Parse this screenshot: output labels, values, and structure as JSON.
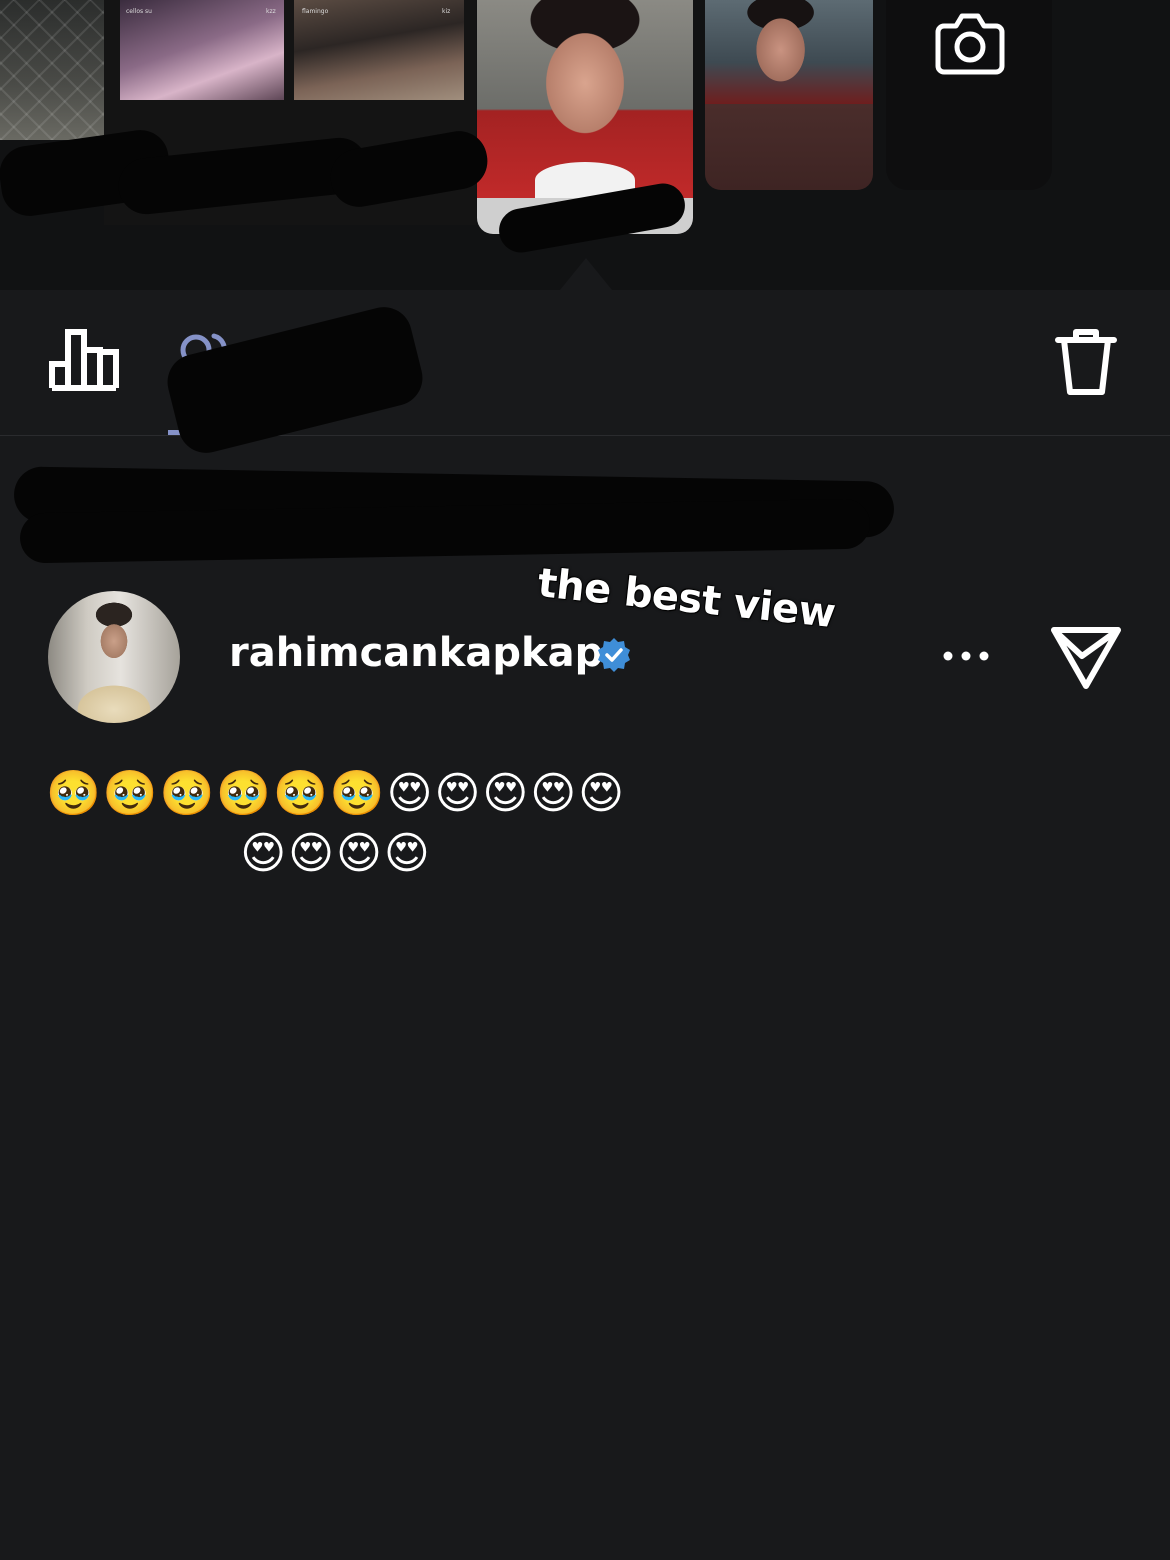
{
  "story_tray": {
    "items": [
      {
        "kind": "story",
        "thumbnail": "fence-photo"
      },
      {
        "kind": "story",
        "thumbnail": "collage-photo",
        "tags": [
          "cellos su",
          "kzz",
          "flamingo",
          "kiz"
        ]
      },
      {
        "kind": "story",
        "thumbnail": "portrait-photo",
        "selected": true
      },
      {
        "kind": "story",
        "thumbnail": "portrait-photo-2"
      },
      {
        "kind": "camera",
        "icon": "camera-icon"
      }
    ]
  },
  "actions": {
    "insights_icon": "bar-chart-icon",
    "viewers_icon": "people-icon",
    "delete_icon": "trash-icon"
  },
  "story": {
    "caption": "the best view"
  },
  "reply": {
    "username": "rahimcankapkap",
    "verified": true,
    "verified_color": "#3f8ed8",
    "comment": "🥹🥹🥹🥹🥹🥹😍😍😍😍😍😍😍😍😍"
  },
  "colors": {
    "background": "#18191b",
    "tray_background": "#111213",
    "tab_accent": "#8592c8"
  }
}
